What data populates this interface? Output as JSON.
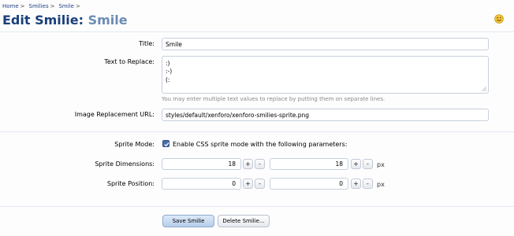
{
  "breadcrumb": {
    "items": [
      "Home",
      "Smilies",
      "Smile"
    ],
    "separator": ">"
  },
  "header": {
    "title": "Edit Smilie:",
    "subtitle": "Smile",
    "icon": "smilie-face-icon"
  },
  "form": {
    "title": {
      "label": "Title:",
      "value": "Smile"
    },
    "text_to_replace": {
      "label": "Text to Replace:",
      "lines": [
        ":)",
        ":-)",
        "(:"
      ],
      "hint": "You may enter multiple text values to replace by putting them on separate lines."
    },
    "image_url": {
      "label": "Image Replacement URL:",
      "value": "styles/default/xenforo/xenforo-smilies-sprite.png"
    },
    "sprite_mode": {
      "label": "Sprite Mode:",
      "checked": true,
      "checkbox_label": "Enable CSS sprite mode with the following parameters:"
    },
    "sprite_dimensions": {
      "label": "Sprite Dimensions:",
      "width": "18",
      "height": "18",
      "unit": "px"
    },
    "sprite_position": {
      "label": "Sprite Position:",
      "x": "0",
      "y": "0",
      "unit": "px"
    },
    "stepper": {
      "plus": "+",
      "minus": "-"
    }
  },
  "buttons": {
    "save": "Save Smilie",
    "delete": "Delete Smilie..."
  },
  "colors": {
    "link": "#1f3f86",
    "title": "#1a3f7a",
    "subtitle": "#6c8bb2",
    "primary_button": "#c8dbf1",
    "checkbox": "#4d6fa8"
  }
}
